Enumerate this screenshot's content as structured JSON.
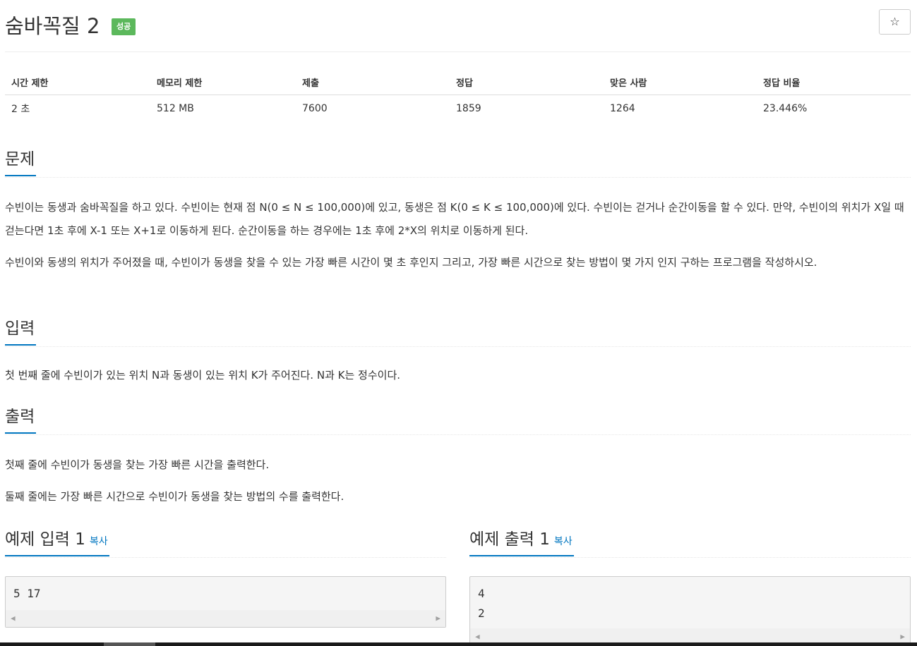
{
  "header": {
    "title": "숨바꼭질 2",
    "badge": "성공",
    "star_icon": "☆"
  },
  "stats": {
    "headers": [
      "시간 제한",
      "메모리 제한",
      "제출",
      "정답",
      "맞은 사람",
      "정답 비율"
    ],
    "values": [
      "2 초",
      "512 MB",
      "7600",
      "1859",
      "1264",
      "23.446%"
    ]
  },
  "problem": {
    "heading": "문제",
    "paragraphs": [
      "수빈이는 동생과 숨바꼭질을 하고 있다. 수빈이는 현재 점 N(0 ≤ N ≤ 100,000)에 있고, 동생은 점 K(0 ≤ K ≤ 100,000)에 있다. 수빈이는 걷거나 순간이동을 할 수 있다. 만약, 수빈이의 위치가 X일 때 걷는다면 1초 후에 X-1 또는 X+1로 이동하게 된다. 순간이동을 하는 경우에는 1초 후에 2*X의 위치로 이동하게 된다.",
      "수빈이와 동생의 위치가 주어졌을 때, 수빈이가 동생을 찾을 수 있는 가장 빠른 시간이 몇 초 후인지 그리고, 가장 빠른 시간으로 찾는 방법이 몇 가지 인지 구하는 프로그램을 작성하시오."
    ]
  },
  "input": {
    "heading": "입력",
    "paragraphs": [
      "첫 번째 줄에 수빈이가 있는 위치 N과 동생이 있는 위치 K가 주어진다. N과 K는 정수이다."
    ]
  },
  "output": {
    "heading": "출력",
    "paragraphs": [
      "첫째 줄에 수빈이가 동생을 찾는 가장 빠른 시간을 출력한다.",
      "둘째 줄에는 가장 빠른 시간으로 수빈이가 동생을 찾는 방법의 수를 출력한다."
    ]
  },
  "sample_input": {
    "heading": "예제 입력 1",
    "copy_label": "복사",
    "lines": [
      "5 17"
    ]
  },
  "sample_output": {
    "heading": "예제 출력 1",
    "copy_label": "복사",
    "lines": [
      "4",
      "2"
    ]
  },
  "colors": {
    "accent": "#0076c0",
    "success": "#5cb85c"
  }
}
